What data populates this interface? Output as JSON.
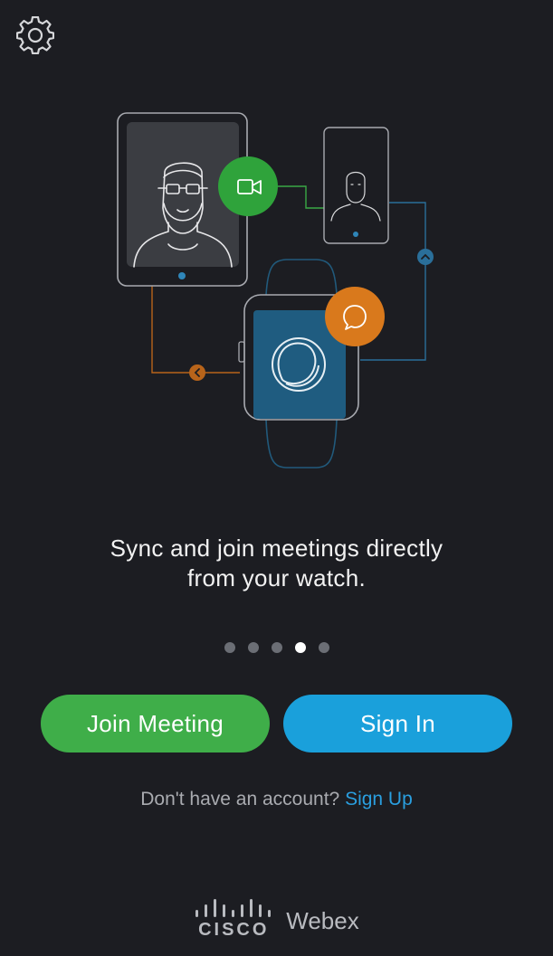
{
  "tagline": {
    "line1": "Sync and join meetings directly",
    "line2": "from your watch."
  },
  "pager": {
    "count": 5,
    "active_index": 3
  },
  "actions": {
    "join_meeting_label": "Join Meeting",
    "sign_in_label": "Sign In"
  },
  "account": {
    "prompt": "Don't have an account?",
    "sign_up_label": "Sign Up"
  },
  "brand": {
    "cisco_text": "CISCO",
    "product_text": "Webex"
  },
  "icons": {
    "settings": "gear-icon",
    "video": "video-camera-icon",
    "chat": "chat-bubble-icon",
    "webex_logo": "webex-logo-icon",
    "arrow_left": "chevron-left-icon",
    "arrow_up": "chevron-up-icon"
  },
  "colors": {
    "background": "#1c1d22",
    "join_button": "#3fae49",
    "sign_in_button": "#1aa0db",
    "sign_up_link": "#2a9fe0",
    "video_badge": "#2fa33b",
    "chat_badge": "#d9791c",
    "watch_screen": "#1f5c80"
  }
}
